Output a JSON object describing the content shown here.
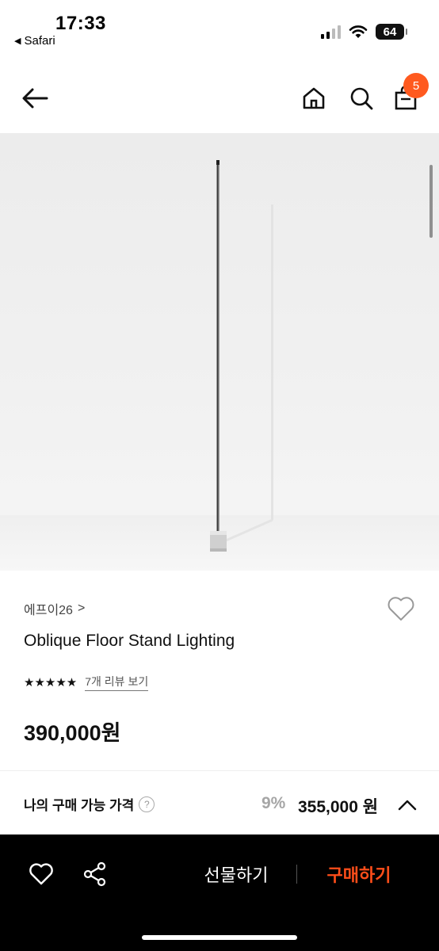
{
  "status_bar": {
    "time": "17:33",
    "back_app": "Safari",
    "battery": "64"
  },
  "header": {
    "cart_count": "5",
    "icons": [
      "back-arrow-icon",
      "home-icon",
      "search-icon",
      "shopping-bag-icon"
    ]
  },
  "product": {
    "brand": "에프이26",
    "brand_chevron": ">",
    "name": "Oblique Floor Stand Lighting",
    "stars": "★★★★★",
    "review_link": "7개 리뷰 보기",
    "price": "390,000원"
  },
  "my_price": {
    "label": "나의 구매 가능 가격",
    "help": "?",
    "discount": "9%",
    "price": "355,000 원"
  },
  "bottom_bar": {
    "gift_label": "선물하기",
    "buy_label": "구매하기"
  },
  "colors": {
    "accent": "#ff5a1f",
    "buy_text": "#ff4e1a",
    "bottom_bar_bg": "#000000"
  }
}
